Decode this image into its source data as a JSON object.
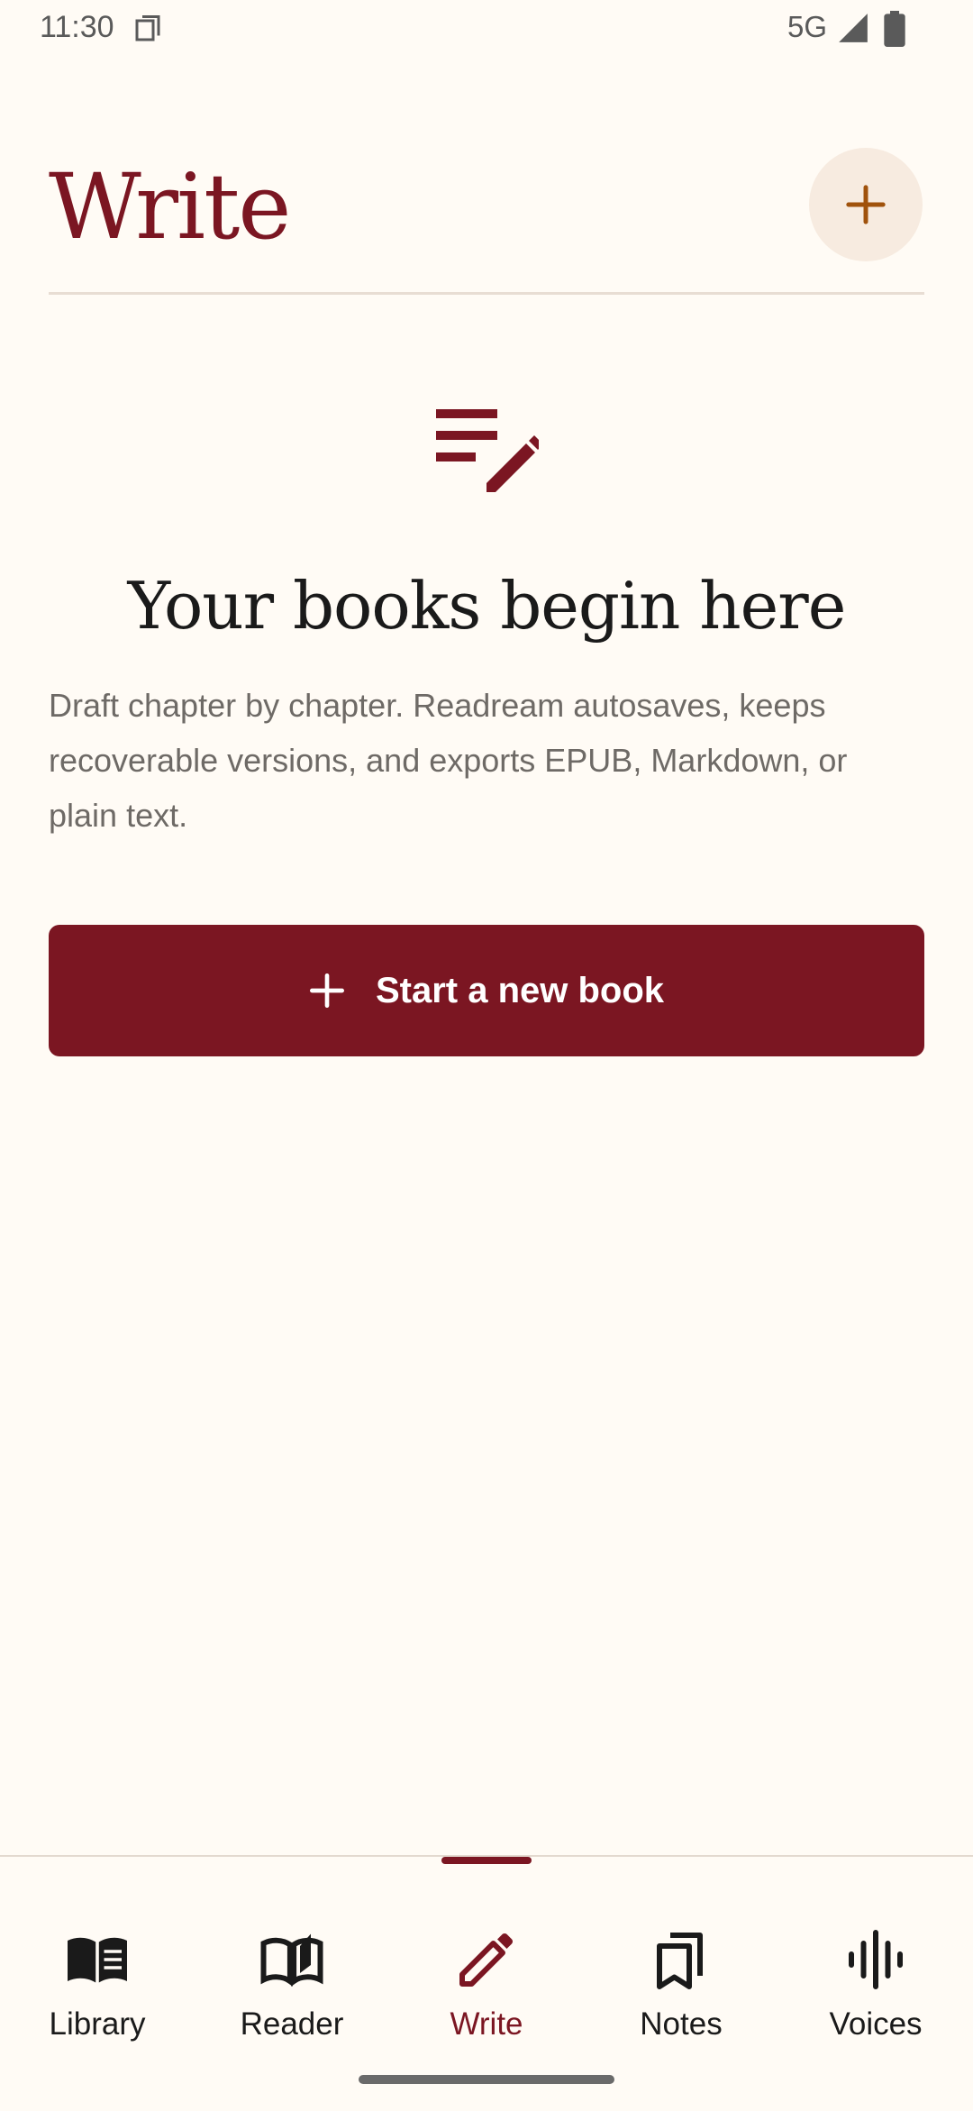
{
  "status_bar": {
    "time": "11:30",
    "network": "5G"
  },
  "header": {
    "title": "Write"
  },
  "empty_state": {
    "title": "Your books begin here",
    "description": "Draft chapter by chapter. Readream autosaves, keeps recoverable versions, and exports EPUB, Markdown, or plain text.",
    "button_label": "Start a new book"
  },
  "bottom_nav": {
    "items": [
      {
        "label": "Library",
        "icon": "book-open-filled-icon"
      },
      {
        "label": "Reader",
        "icon": "book-reader-icon"
      },
      {
        "label": "Write",
        "icon": "pencil-icon"
      },
      {
        "label": "Notes",
        "icon": "bookmarks-icon"
      },
      {
        "label": "Voices",
        "icon": "audio-wave-icon"
      }
    ],
    "active_index": 2
  },
  "colors": {
    "accent": "#7B1622",
    "background": "#FFFBF5",
    "fab_background": "#F7EBE0",
    "fab_icon": "#A0520C"
  }
}
